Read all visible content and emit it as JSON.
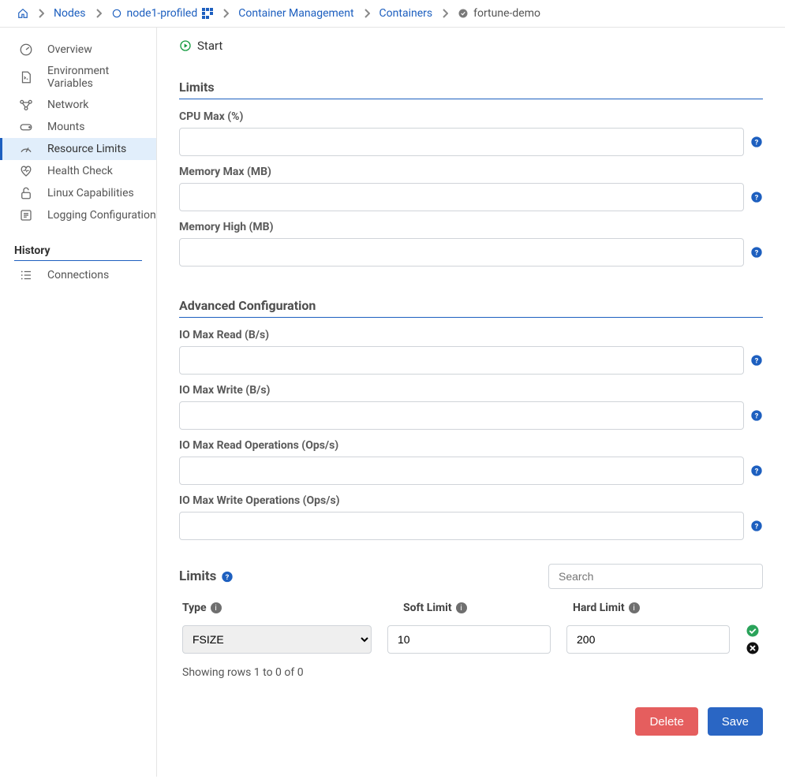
{
  "breadcrumb": {
    "home": "",
    "nodes": "Nodes",
    "node": "node1-profiled",
    "cm": "Container Management",
    "containers": "Containers",
    "current": "fortune-demo"
  },
  "sidebar": {
    "items": [
      {
        "label": "Overview",
        "icon": "gauge"
      },
      {
        "label": "Environment Variables",
        "icon": "doc"
      },
      {
        "label": "Network",
        "icon": "net"
      },
      {
        "label": "Mounts",
        "icon": "disk"
      },
      {
        "label": "Resource Limits",
        "icon": "meter"
      },
      {
        "label": "Health Check",
        "icon": "heart"
      },
      {
        "label": "Linux Capabilities",
        "icon": "lock"
      },
      {
        "label": "Logging Configuration",
        "icon": "list"
      }
    ],
    "history_label": "History",
    "history_items": [
      {
        "label": "Connections",
        "icon": "listnum"
      }
    ]
  },
  "main": {
    "start": "Start",
    "limits_title": "Limits",
    "fields": {
      "cpu_max": {
        "label": "CPU Max (%)",
        "value": ""
      },
      "mem_max": {
        "label": "Memory Max (MB)",
        "value": ""
      },
      "mem_high": {
        "label": "Memory High (MB)",
        "value": ""
      }
    },
    "adv_title": "Advanced Configuration",
    "adv_fields": {
      "io_r": {
        "label": "IO Max Read (B/s)",
        "value": ""
      },
      "io_w": {
        "label": "IO Max Write (B/s)",
        "value": ""
      },
      "io_ro": {
        "label": "IO Max Read Operations (Ops/s)",
        "value": ""
      },
      "io_wo": {
        "label": "IO Max Write Operations (Ops/s)",
        "value": ""
      }
    },
    "limits_table": {
      "title": "Limits",
      "search_ph": "Search",
      "cols": {
        "type": "Type",
        "soft": "Soft Limit",
        "hard": "Hard Limit"
      },
      "row": {
        "type": "FSIZE",
        "soft": "10",
        "hard": "200"
      },
      "showing": "Showing rows 1 to 0 of 0"
    },
    "buttons": {
      "delete": "Delete",
      "save": "Save"
    }
  }
}
